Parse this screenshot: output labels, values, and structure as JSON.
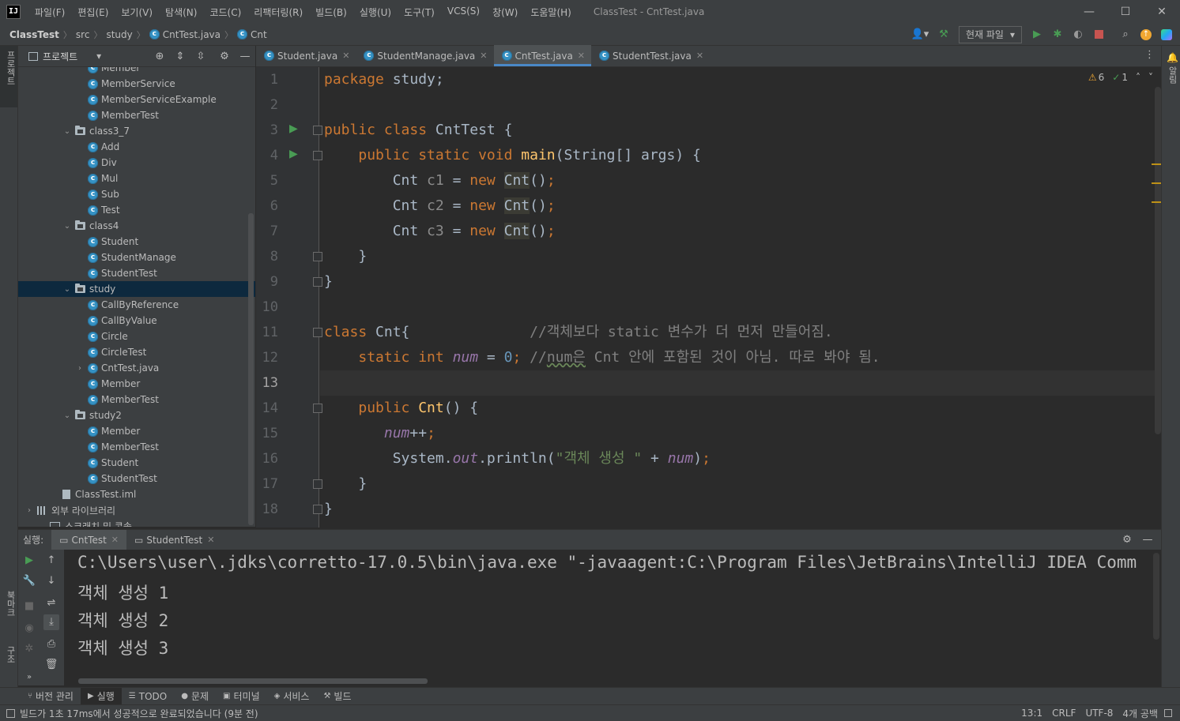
{
  "menubar": {
    "logo": "IJ",
    "items": [
      "파일(F)",
      "편집(E)",
      "보기(V)",
      "탐색(N)",
      "코드(C)",
      "리팩터링(R)",
      "빌드(B)",
      "실행(U)",
      "도구(T)",
      "VCS(S)",
      "창(W)",
      "도움말(H)"
    ],
    "window_title": "ClassTest - CntTest.java"
  },
  "navbar": {
    "breadcrumbs": [
      "ClassTest",
      "src",
      "study",
      "CntTest.java",
      "Cnt"
    ],
    "run_config": "현재 파일"
  },
  "left_stripe": {
    "project": "프로젝트",
    "bookmarks": "북마크",
    "structure": "구조"
  },
  "right_stripe": {
    "notifications": "알림"
  },
  "project_panel": {
    "title": "프로젝트",
    "tree": [
      {
        "label": "Member",
        "indent": 5,
        "type": "class"
      },
      {
        "label": "MemberService",
        "indent": 5,
        "type": "class"
      },
      {
        "label": "MemberServiceExample",
        "indent": 5,
        "type": "class"
      },
      {
        "label": "MemberTest",
        "indent": 5,
        "type": "class"
      },
      {
        "label": "class3_7",
        "indent": 3,
        "type": "folder",
        "expanded": true
      },
      {
        "label": "Add",
        "indent": 5,
        "type": "class"
      },
      {
        "label": "Div",
        "indent": 5,
        "type": "class"
      },
      {
        "label": "Mul",
        "indent": 5,
        "type": "class"
      },
      {
        "label": "Sub",
        "indent": 5,
        "type": "class"
      },
      {
        "label": "Test",
        "indent": 5,
        "type": "class"
      },
      {
        "label": "class4",
        "indent": 3,
        "type": "folder",
        "expanded": true
      },
      {
        "label": "Student",
        "indent": 5,
        "type": "class"
      },
      {
        "label": "StudentManage",
        "indent": 5,
        "type": "class"
      },
      {
        "label": "StudentTest",
        "indent": 5,
        "type": "class"
      },
      {
        "label": "study",
        "indent": 3,
        "type": "folder",
        "expanded": true,
        "selected": true
      },
      {
        "label": "CallByReference",
        "indent": 5,
        "type": "class"
      },
      {
        "label": "CallByValue",
        "indent": 5,
        "type": "class"
      },
      {
        "label": "Circle",
        "indent": 5,
        "type": "class"
      },
      {
        "label": "CircleTest",
        "indent": 5,
        "type": "class"
      },
      {
        "label": "CntTest.java",
        "indent": 4,
        "type": "classfile",
        "collapsed": true
      },
      {
        "label": "Member",
        "indent": 5,
        "type": "class"
      },
      {
        "label": "MemberTest",
        "indent": 5,
        "type": "class"
      },
      {
        "label": "study2",
        "indent": 3,
        "type": "folder",
        "expanded": true
      },
      {
        "label": "Member",
        "indent": 5,
        "type": "class"
      },
      {
        "label": "MemberTest",
        "indent": 5,
        "type": "class"
      },
      {
        "label": "Student",
        "indent": 5,
        "type": "class"
      },
      {
        "label": "StudentTest",
        "indent": 5,
        "type": "class"
      },
      {
        "label": "ClassTest.iml",
        "indent": 2,
        "type": "iml"
      },
      {
        "label": "외부 라이브러리",
        "indent": 0,
        "type": "lib",
        "collapsed": true
      },
      {
        "label": "스크래치 및 콘솔",
        "indent": 1,
        "type": "scratch"
      }
    ]
  },
  "editor_tabs": [
    {
      "label": "Student.java",
      "active": false
    },
    {
      "label": "StudentManage.java",
      "active": false
    },
    {
      "label": "CntTest.java",
      "active": true
    },
    {
      "label": "StudentTest.java",
      "active": false
    }
  ],
  "editor": {
    "warnings": "6",
    "checks": "1",
    "current_line": 13,
    "lines": [
      [
        [
          "kw",
          "package "
        ],
        [
          "p",
          "study;"
        ]
      ],
      [],
      [
        [
          "kw",
          "public class "
        ],
        [
          "p",
          "CntTest {"
        ]
      ],
      [
        [
          "p",
          "    "
        ],
        [
          "kw",
          "public static void "
        ],
        [
          "fn",
          "main"
        ],
        [
          "p",
          "(String[] args) {"
        ]
      ],
      [
        [
          "p",
          "        Cnt "
        ],
        [
          "u",
          "c1"
        ],
        [
          "p",
          " = "
        ],
        [
          "kw",
          "new "
        ],
        [
          "ref",
          "Cnt"
        ],
        [
          "p",
          "()"
        ],
        [
          "kw",
          ";"
        ]
      ],
      [
        [
          "p",
          "        Cnt "
        ],
        [
          "u",
          "c2"
        ],
        [
          "p",
          " = "
        ],
        [
          "kw",
          "new "
        ],
        [
          "ref",
          "Cnt"
        ],
        [
          "p",
          "()"
        ],
        [
          "kw",
          ";"
        ]
      ],
      [
        [
          "p",
          "        Cnt "
        ],
        [
          "u",
          "c3"
        ],
        [
          "p",
          " = "
        ],
        [
          "kw",
          "new "
        ],
        [
          "ref",
          "Cnt"
        ],
        [
          "p",
          "()"
        ],
        [
          "kw",
          ";"
        ]
      ],
      [
        [
          "p",
          "    }"
        ]
      ],
      [
        [
          "p",
          "}"
        ]
      ],
      [],
      [
        [
          "kw",
          "class "
        ],
        [
          "p",
          "Cnt{              "
        ],
        [
          "cmt",
          "//객체보다 static 변수가 더 먼저 만들어짐."
        ]
      ],
      [
        [
          "p",
          "    "
        ],
        [
          "kw",
          "static int "
        ],
        [
          "sf",
          "num"
        ],
        [
          "p",
          " = "
        ],
        [
          "num",
          "0"
        ],
        [
          "kw",
          "; "
        ],
        [
          "cmt",
          "//"
        ],
        [
          "cmtu",
          "num은"
        ],
        [
          "cmt",
          " Cnt 안에 포함된 것이 아님. 따로 봐야 됨."
        ]
      ],
      [],
      [
        [
          "p",
          "    "
        ],
        [
          "kw",
          "public "
        ],
        [
          "fn",
          "Cnt"
        ],
        [
          "p",
          "() {"
        ]
      ],
      [
        [
          "p",
          "       "
        ],
        [
          "sf",
          "num"
        ],
        [
          "p",
          "++"
        ],
        [
          "kw",
          ";"
        ]
      ],
      [
        [
          "p",
          "        System."
        ],
        [
          "sf",
          "out"
        ],
        [
          "p",
          ".println("
        ],
        [
          "str",
          "\"객체 생성 \""
        ],
        [
          "p",
          " + "
        ],
        [
          "sf",
          "num"
        ],
        [
          "p",
          ")"
        ],
        [
          "kw",
          ";"
        ]
      ],
      [
        [
          "p",
          "    }"
        ]
      ],
      [
        [
          "p",
          "}"
        ]
      ]
    ]
  },
  "run_panel": {
    "label": "실행:",
    "tabs": [
      {
        "label": "CntTest",
        "active": true
      },
      {
        "label": "StudentTest",
        "active": false
      }
    ],
    "console": [
      "C:\\Users\\user\\.jdks\\corretto-17.0.5\\bin\\java.exe \"-javaagent:C:\\Program Files\\JetBrains\\IntelliJ IDEA Comm",
      "객체 생성 1",
      "객체 생성 2",
      "객체 생성 3"
    ]
  },
  "bottom_tools": [
    {
      "icon": "git-branch-icon",
      "label": "버전 관리"
    },
    {
      "icon": "run-icon",
      "label": "실행",
      "active": true
    },
    {
      "icon": "todo-icon",
      "label": "TODO"
    },
    {
      "icon": "problems-icon",
      "label": "문제"
    },
    {
      "icon": "terminal-icon",
      "label": "터미널"
    },
    {
      "icon": "services-icon",
      "label": "서비스"
    },
    {
      "icon": "build-icon",
      "label": "빌드"
    }
  ],
  "statusbar": {
    "message": "빌드가 1초 17ms에서 성공적으로 완료되었습니다 (9분 전)",
    "position": "13:1",
    "line_sep": "CRLF",
    "encoding": "UTF-8",
    "indent": "4개 공백"
  },
  "colors": {
    "keyword": "#cc7832",
    "static_field": "#9876aa",
    "number": "#6897bb",
    "string": "#6a8759",
    "comment": "#808080",
    "method": "#ffc66d",
    "selection": "#0d293e",
    "run_green": "#499c54"
  }
}
